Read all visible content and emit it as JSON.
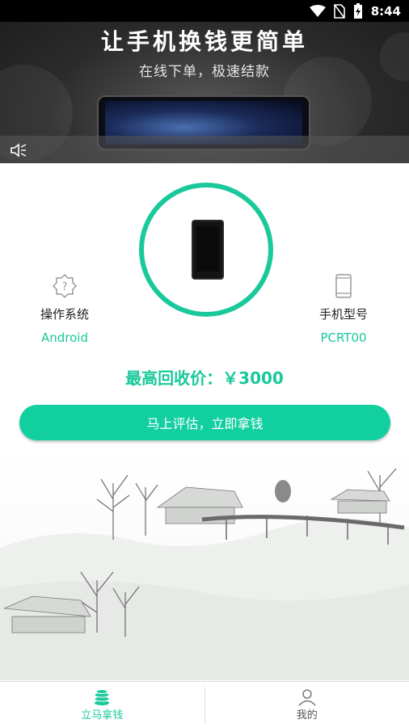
{
  "status_bar": {
    "time": "8:44"
  },
  "banner": {
    "title": "让手机换钱更简单",
    "subtitle": "在线下单，极速结款"
  },
  "device": {
    "os_label": "操作系统",
    "os_value": "Android",
    "model_label": "手机型号",
    "model_value": "PCRT00"
  },
  "price_text": "最高回收价：￥3000",
  "cta_label": "马上评估，立即拿钱",
  "bottom_nav": [
    {
      "label": "立马拿钱",
      "icon": "coins-icon",
      "active": true
    },
    {
      "label": "我的",
      "icon": "user-icon",
      "active": false
    }
  ],
  "colors": {
    "accent": "#19c99b",
    "button": "#12cfa0"
  }
}
